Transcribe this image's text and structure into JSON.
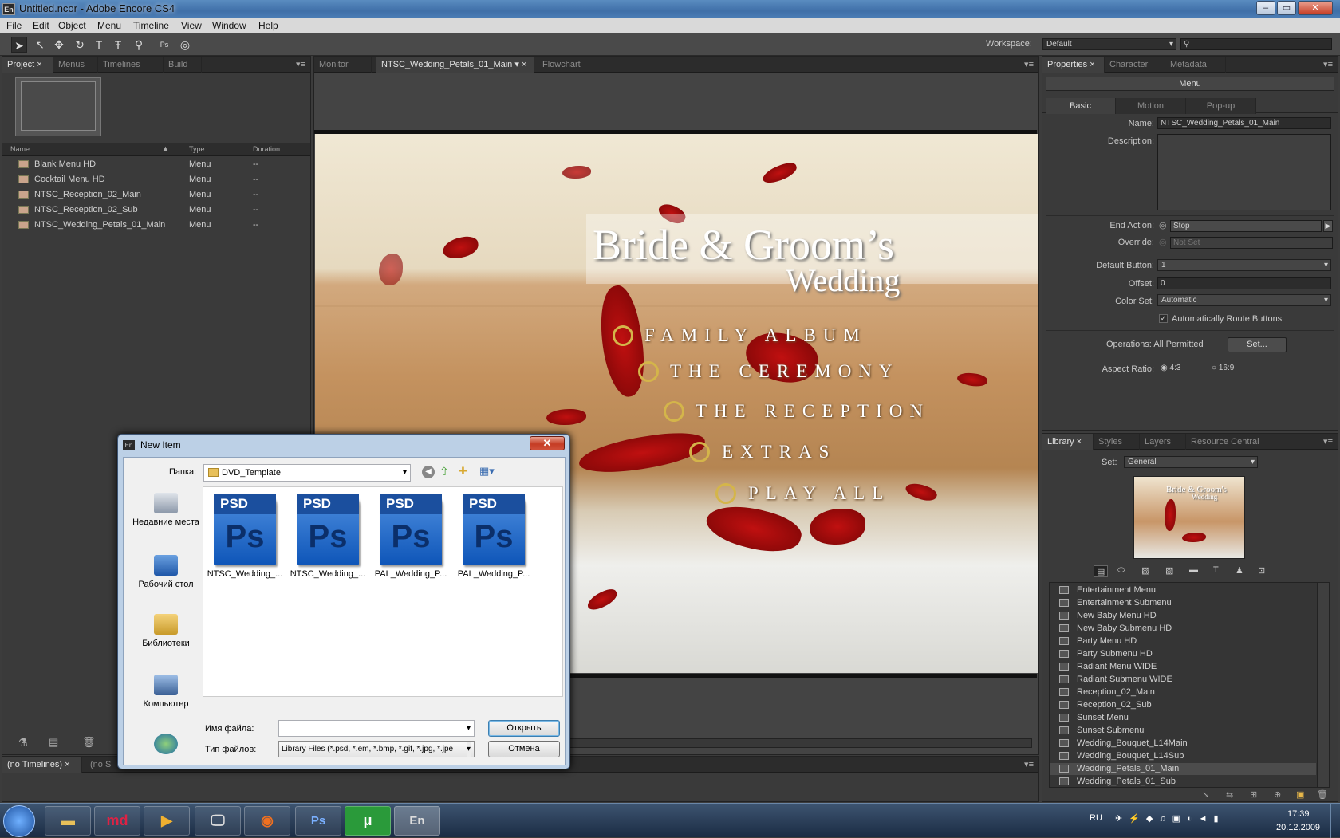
{
  "window": {
    "title": "Untitled.ncor - Adobe Encore CS4",
    "app_icon": "En",
    "controls": [
      "–",
      "▭",
      "✕"
    ]
  },
  "menubar": [
    "File",
    "Edit",
    "Object",
    "Menu",
    "Timeline",
    "View",
    "Window",
    "Help"
  ],
  "toolbar": {
    "workspace_label": "Workspace:",
    "workspace_value": "Default",
    "search_placeholder": ""
  },
  "project_panel": {
    "tabs": [
      "Project",
      "Menus",
      "Timelines",
      "Build"
    ],
    "columns": [
      "Name",
      "Type",
      "Duration"
    ],
    "rows": [
      {
        "name": "Blank Menu HD",
        "type": "Menu",
        "duration": "--"
      },
      {
        "name": "Cocktail Menu HD",
        "type": "Menu",
        "duration": "--"
      },
      {
        "name": "NTSC_Reception_02_Main",
        "type": "Menu",
        "duration": "--"
      },
      {
        "name": "NTSC_Reception_02_Sub",
        "type": "Menu",
        "duration": "--"
      },
      {
        "name": "NTSC_Wedding_Petals_01_Main",
        "type": "Menu",
        "duration": "--"
      }
    ]
  },
  "monitor_panel": {
    "tabs": [
      "Monitor",
      "NTSC_Wedding_Petals_01_Main",
      "Flowchart"
    ]
  },
  "menu_canvas": {
    "title_line1": "Bride & Groom’s",
    "title_line2": "Wedding",
    "buttons": [
      "FAMILY ALBUM",
      "THE CEREMONY",
      "THE RECEPTION",
      "EXTRAS",
      "PLAY ALL"
    ]
  },
  "timeline_panel": {
    "tabs": [
      "(no Timelines)",
      "(no Sl"
    ]
  },
  "properties_panel": {
    "tabs": [
      "Properties",
      "Character",
      "Metadata"
    ],
    "header": "Menu",
    "subtabs": [
      "Basic",
      "Motion",
      "Pop-up"
    ],
    "name_label": "Name:",
    "name_value": "NTSC_Wedding_Petals_01_Main",
    "description_label": "Description:",
    "end_action_label": "End Action:",
    "end_action_value": "Stop",
    "override_label": "Override:",
    "override_value": "Not Set",
    "default_button_label": "Default Button:",
    "default_button_value": "1",
    "offset_label": "Offset:",
    "offset_value": "0",
    "color_set_label": "Color Set:",
    "color_set_value": "Automatic",
    "auto_route_label": "Automatically Route Buttons",
    "operations_label": "Operations: All Permitted",
    "set_button": "Set...",
    "aspect_label": "Aspect Ratio:",
    "aspect_43": "4:3",
    "aspect_169": "16:9"
  },
  "library_panel": {
    "tabs": [
      "Library",
      "Styles",
      "Layers",
      "Resource Central"
    ],
    "set_label": "Set:",
    "set_value": "General",
    "preview": {
      "title": "Bride & Groom's",
      "subtitle": "Wedding"
    },
    "items": [
      "Entertainment Menu",
      "Entertainment Submenu",
      "New Baby Menu HD",
      "New Baby Submenu HD",
      "Party Menu HD",
      "Party Submenu HD",
      "Radiant Menu WIDE",
      "Radiant Submenu WIDE",
      "Reception_02_Main",
      "Reception_02_Sub",
      "Sunset Menu",
      "Sunset Submenu",
      "Wedding_Bouquet_L14Main",
      "Wedding_Bouquet_L14Sub",
      "Wedding_Petals_01_Main",
      "Wedding_Petals_01_Sub"
    ],
    "selected": "Wedding_Petals_01_Main"
  },
  "dialog": {
    "title": "New Item",
    "icon": "En",
    "folder_label": "Папка:",
    "folder_value": "DVD_Template",
    "places": [
      "Недавние места",
      "Рабочий стол",
      "Библиотеки",
      "Компьютер",
      ""
    ],
    "files": [
      "NTSC_Wedding_...",
      "NTSC_Wedding_...",
      "PAL_Wedding_P...",
      "PAL_Wedding_P..."
    ],
    "file_icon_badge": "PSD",
    "file_icon_letters": "Ps",
    "filename_label": "Имя файла:",
    "filename_value": "",
    "filetype_label": "Тип файлов:",
    "filetype_value": "Library Files (*.psd, *.em, *.bmp, *.gif, *.jpg, *.jpe",
    "open_button": "Открыть",
    "cancel_button": "Отмена"
  },
  "taskbar": {
    "apps": [
      "",
      "",
      "md",
      "",
      "",
      "",
      "Ps",
      "μ",
      "En"
    ],
    "lang": "RU",
    "time": "17:39",
    "date": "20.12.2009"
  },
  "colors": {
    "panel_bg": "#3a3a3a",
    "tab_bg": "#2c2c2c",
    "accent": "#4b7db5"
  }
}
